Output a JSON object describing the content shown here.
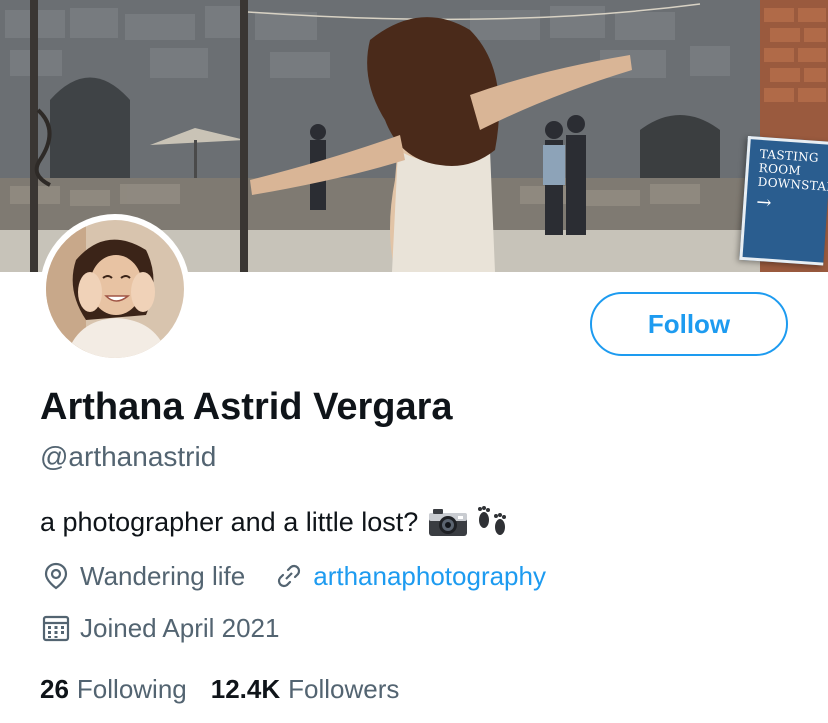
{
  "profile": {
    "display_name": "Arthana Astrid Vergara",
    "handle": "@arthanastrid",
    "bio": "a photographer and a little lost?",
    "bio_emojis": [
      "camera-icon",
      "footprints-icon"
    ],
    "location": "Wandering life",
    "website": "arthanaphotography",
    "joined": "Joined April 2021"
  },
  "actions": {
    "follow_label": "Follow"
  },
  "stats": {
    "following_count": "26",
    "following_label": "Following",
    "followers_count": "12.4K",
    "followers_label": "Followers"
  },
  "banner": {
    "sign_lines": [
      "TASTING",
      "ROOM",
      "DOWNSTAIRS"
    ],
    "sign_arrow": "→"
  },
  "colors": {
    "accent": "#1d9bf0",
    "text_primary": "#0f1419",
    "text_secondary": "#536471",
    "sign_blue": "#2a5d8f"
  },
  "icons": {
    "location": "location-pin-icon",
    "website": "link-icon",
    "joined": "calendar-icon"
  }
}
